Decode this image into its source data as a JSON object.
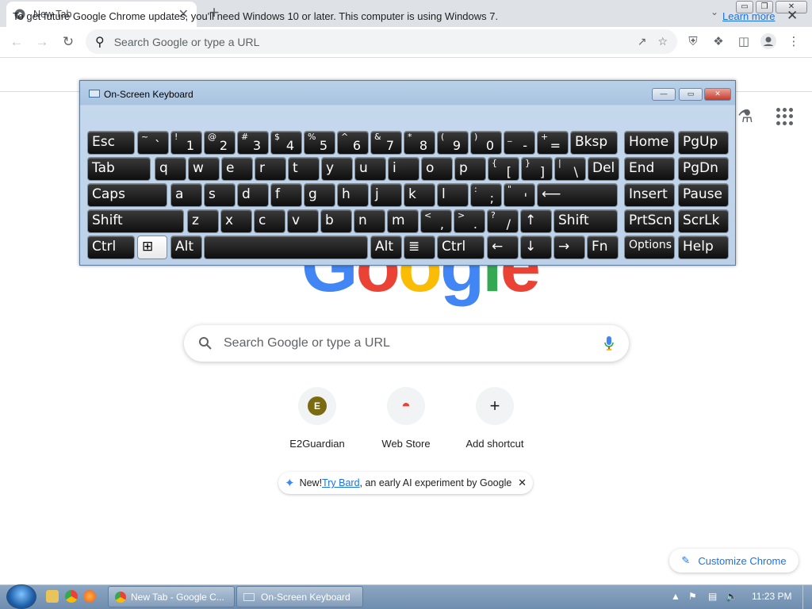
{
  "browser": {
    "tab_title": "New Tab",
    "tab_close": "✕",
    "new_tab": "+",
    "tab_search": "⌄",
    "window_buttons": [
      "▭",
      "❐",
      "✕"
    ],
    "omnibox_placeholder": "Search Google or type a URL",
    "nav": {
      "back": "←",
      "forward": "→",
      "reload": "↻"
    }
  },
  "infobar": {
    "message": "To get future Google Chrome updates, you'll need Windows 10 or later. This computer is using Windows 7.",
    "link": "Learn more",
    "close": "✕"
  },
  "ntp": {
    "logo_letters": [
      {
        "ch": "G",
        "color": "#4285f4"
      },
      {
        "ch": "o",
        "color": "#ea4335"
      },
      {
        "ch": "o",
        "color": "#fbbc05"
      },
      {
        "ch": "g",
        "color": "#4285f4"
      },
      {
        "ch": "l",
        "color": "#34a853"
      },
      {
        "ch": "e",
        "color": "#ea4335"
      }
    ],
    "search_placeholder": "Search Google or type a URL",
    "shortcuts": [
      {
        "label": "E2Guardian",
        "glyph": "E",
        "color": "#7a6a12"
      },
      {
        "label": "Web Store",
        "glyph": "◓",
        "color": "#ea4335"
      },
      {
        "label": "Add shortcut",
        "glyph": "+",
        "color": "#202124"
      }
    ],
    "bard": {
      "prefix": "New! ",
      "link": "Try Bard",
      "suffix": ", an early AI experiment by Google",
      "close": "✕"
    },
    "customize": "Customize Chrome"
  },
  "osk": {
    "title": "On-Screen Keyboard",
    "buttons": [
      "—",
      "▭",
      "✕"
    ],
    "keys": [
      {
        "r": 0,
        "c": 0,
        "lb": "Esc"
      },
      {
        "r": 0,
        "c": 1,
        "sh": "~",
        "mn": "`"
      },
      {
        "r": 0,
        "c": 2,
        "sh": "!",
        "mn": "1"
      },
      {
        "r": 0,
        "c": 3,
        "sh": "@",
        "mn": "2"
      },
      {
        "r": 0,
        "c": 4,
        "sh": "#",
        "mn": "3"
      },
      {
        "r": 0,
        "c": 5,
        "sh": "$",
        "mn": "4"
      },
      {
        "r": 0,
        "c": 6,
        "sh": "%",
        "mn": "5"
      },
      {
        "r": 0,
        "c": 7,
        "sh": "^",
        "mn": "6"
      },
      {
        "r": 0,
        "c": 8,
        "sh": "&",
        "mn": "7"
      },
      {
        "r": 0,
        "c": 9,
        "sh": "*",
        "mn": "8"
      },
      {
        "r": 0,
        "c": 10,
        "sh": "(",
        "mn": "9"
      },
      {
        "r": 0,
        "c": 11,
        "sh": ")",
        "mn": "0"
      },
      {
        "r": 0,
        "c": 12,
        "sh": "_",
        "mn": "-"
      },
      {
        "r": 0,
        "c": 13,
        "sh": "+",
        "mn": "="
      },
      {
        "r": 0,
        "c": 14,
        "lb": "Bksp"
      },
      {
        "r": 0,
        "c": 15,
        "lb": "Home"
      },
      {
        "r": 0,
        "c": 16,
        "lb": "PgUp"
      },
      {
        "r": 1,
        "c": 0,
        "lb": "Tab"
      },
      {
        "r": 1,
        "c": 1,
        "lb": "q"
      },
      {
        "r": 1,
        "c": 2,
        "lb": "w"
      },
      {
        "r": 1,
        "c": 3,
        "lb": "e"
      },
      {
        "r": 1,
        "c": 4,
        "lb": "r"
      },
      {
        "r": 1,
        "c": 5,
        "lb": "t"
      },
      {
        "r": 1,
        "c": 6,
        "lb": "y"
      },
      {
        "r": 1,
        "c": 7,
        "lb": "u"
      },
      {
        "r": 1,
        "c": 8,
        "lb": "i"
      },
      {
        "r": 1,
        "c": 9,
        "lb": "o"
      },
      {
        "r": 1,
        "c": 10,
        "lb": "p"
      },
      {
        "r": 1,
        "c": 11,
        "sh": "{",
        "mn": "["
      },
      {
        "r": 1,
        "c": 12,
        "sh": "}",
        "mn": "]"
      },
      {
        "r": 1,
        "c": 13,
        "sh": "|",
        "mn": "\\"
      },
      {
        "r": 1,
        "c": 14,
        "lb": "Del"
      },
      {
        "r": 1,
        "c": 15,
        "lb": "End"
      },
      {
        "r": 1,
        "c": 16,
        "lb": "PgDn"
      },
      {
        "r": 2,
        "c": 0,
        "lb": "Caps"
      },
      {
        "r": 2,
        "c": 1,
        "lb": "a"
      },
      {
        "r": 2,
        "c": 2,
        "lb": "s"
      },
      {
        "r": 2,
        "c": 3,
        "lb": "d"
      },
      {
        "r": 2,
        "c": 4,
        "lb": "f"
      },
      {
        "r": 2,
        "c": 5,
        "lb": "g"
      },
      {
        "r": 2,
        "c": 6,
        "lb": "h"
      },
      {
        "r": 2,
        "c": 7,
        "lb": "j"
      },
      {
        "r": 2,
        "c": 8,
        "lb": "k"
      },
      {
        "r": 2,
        "c": 9,
        "lb": "l"
      },
      {
        "r": 2,
        "c": 10,
        "sh": ":",
        "mn": ";"
      },
      {
        "r": 2,
        "c": 11,
        "sh": "\"",
        "mn": "'"
      },
      {
        "r": 2,
        "c": 12,
        "lb": "⟵"
      },
      {
        "r": 2,
        "c": 13,
        "lb": "Insert"
      },
      {
        "r": 2,
        "c": 14,
        "lb": "Pause"
      },
      {
        "r": 3,
        "c": 0,
        "lb": "Shift"
      },
      {
        "r": 3,
        "c": 1,
        "lb": "z"
      },
      {
        "r": 3,
        "c": 2,
        "lb": "x"
      },
      {
        "r": 3,
        "c": 3,
        "lb": "c"
      },
      {
        "r": 3,
        "c": 4,
        "lb": "v"
      },
      {
        "r": 3,
        "c": 5,
        "lb": "b"
      },
      {
        "r": 3,
        "c": 6,
        "lb": "n"
      },
      {
        "r": 3,
        "c": 7,
        "lb": "m"
      },
      {
        "r": 3,
        "c": 8,
        "sh": "<",
        "mn": ","
      },
      {
        "r": 3,
        "c": 9,
        "sh": ">",
        "mn": "."
      },
      {
        "r": 3,
        "c": 10,
        "sh": "?",
        "mn": "/"
      },
      {
        "r": 3,
        "c": 11,
        "lb": "↑"
      },
      {
        "r": 3,
        "c": 12,
        "lb": "Shift"
      },
      {
        "r": 3,
        "c": 13,
        "lb": "PrtScn"
      },
      {
        "r": 3,
        "c": 14,
        "lb": "ScrLk"
      },
      {
        "r": 4,
        "c": 0,
        "lb": "Ctrl"
      },
      {
        "r": 4,
        "c": 1,
        "lb": "⊞",
        "white": true
      },
      {
        "r": 4,
        "c": 2,
        "lb": "Alt"
      },
      {
        "r": 4,
        "c": 3,
        "lb": ""
      },
      {
        "r": 4,
        "c": 4,
        "lb": "Alt"
      },
      {
        "r": 4,
        "c": 5,
        "lb": "≣"
      },
      {
        "r": 4,
        "c": 6,
        "lb": "Ctrl"
      },
      {
        "r": 4,
        "c": 7,
        "lb": "←"
      },
      {
        "r": 4,
        "c": 8,
        "lb": "↓"
      },
      {
        "r": 4,
        "c": 9,
        "lb": "→"
      },
      {
        "r": 4,
        "c": 10,
        "lb": "Fn"
      },
      {
        "r": 4,
        "c": 11,
        "lb": "Options"
      },
      {
        "r": 4,
        "c": 12,
        "lb": "Help"
      }
    ]
  },
  "taskbar": {
    "tasks": [
      "New Tab - Google C...",
      "On-Screen Keyboard"
    ],
    "clock": "11:23 PM"
  }
}
